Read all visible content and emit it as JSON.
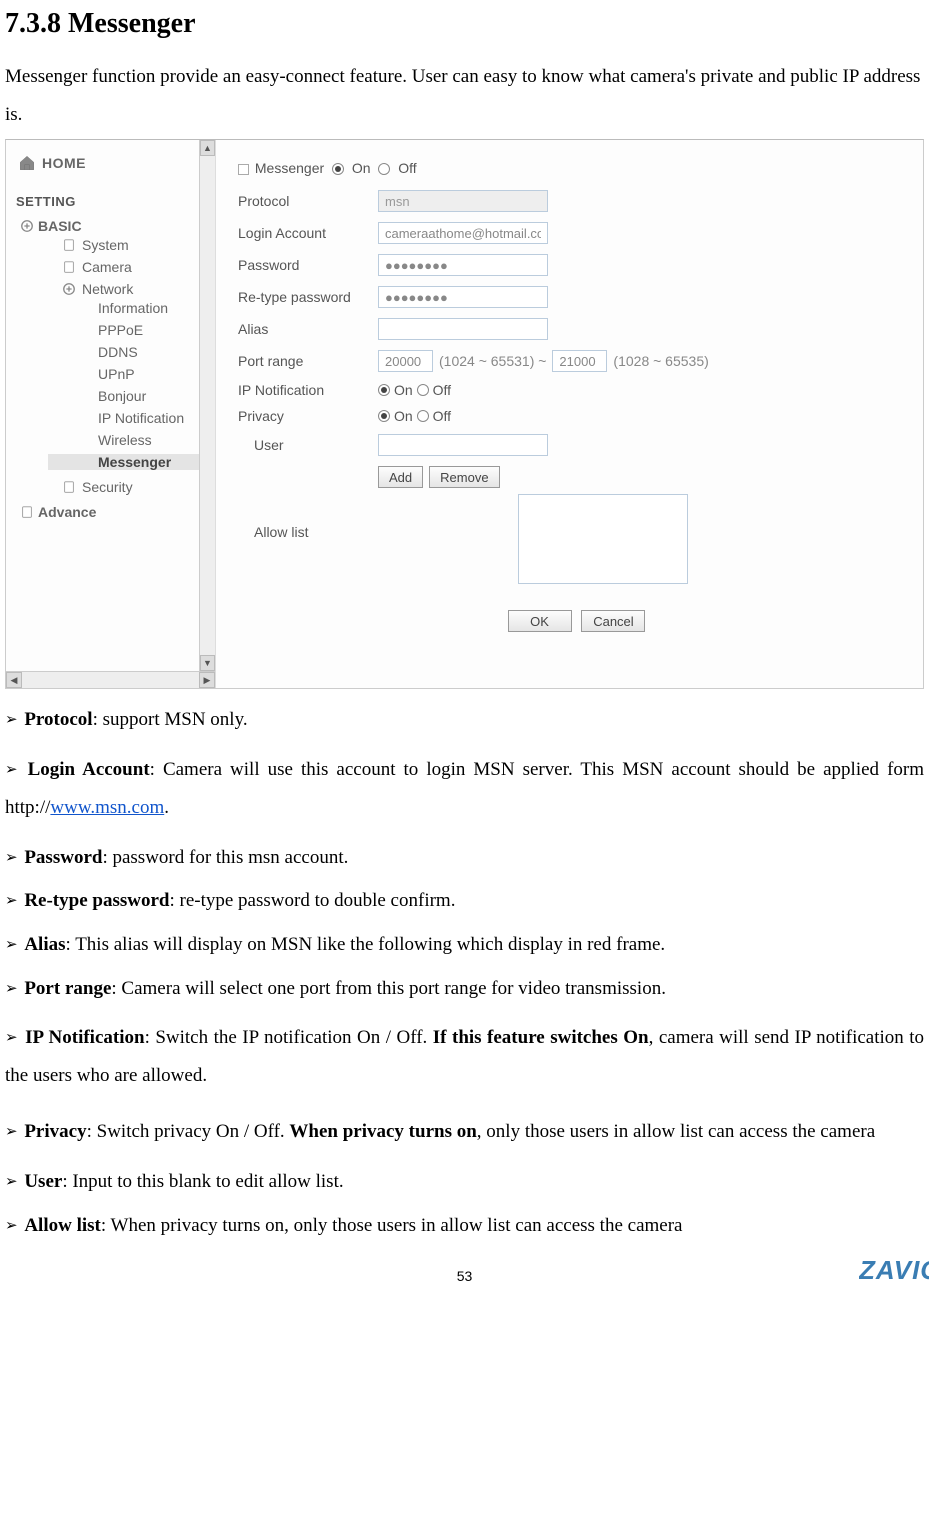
{
  "doc": {
    "heading": "7.3.8 Messenger",
    "intro": "Messenger function provide an easy-connect feature. User can easy to know what camera's private and public IP address is."
  },
  "sidebar": {
    "home": "HOME",
    "setting": "SETTING",
    "basic": "BASIC",
    "items": {
      "system": "System",
      "camera": "Camera",
      "network": "Network",
      "information": "Information",
      "pppoe": "PPPoE",
      "ddns": "DDNS",
      "upnp": "UPnP",
      "bonjour": "Bonjour",
      "ipnotif": "IP Notification",
      "wireless": "Wireless",
      "messenger": "Messenger",
      "security": "Security",
      "advance": "Advance"
    }
  },
  "form": {
    "title_prefix": "Messenger",
    "on": "On",
    "off": "Off",
    "protocol_label": "Protocol",
    "protocol_value": "msn",
    "login_label": "Login Account",
    "login_value": "cameraathome@hotmail.com",
    "password_label": "Password",
    "password_value": "●●●●●●●●",
    "retype_label": "Re-type password",
    "retype_value": "●●●●●●●●",
    "alias_label": "Alias",
    "alias_value": "",
    "port_label": "Port range",
    "port_from": "20000",
    "port_hint_from": "(1024 ~ 65531) ~",
    "port_to": "21000",
    "port_hint_to": "(1028 ~ 65535)",
    "ipnotif_label": "IP Notification",
    "privacy_label": "Privacy",
    "user_label": "User",
    "user_value": "",
    "add": "Add",
    "remove": "Remove",
    "allowlist_label": "Allow list",
    "ok": "OK",
    "cancel": "Cancel"
  },
  "bullets": {
    "protocol_b": "Protocol",
    "protocol_t": ": support MSN only.",
    "login_b": "Login Account",
    "login_t": ": Camera will use this account to login MSN server. This MSN account should be applied form http://",
    "login_link": "www.msn.com",
    "login_t2": ".",
    "password_b": "Password",
    "password_t": ": password for this msn account.",
    "retype_b": "Re-type password",
    "retype_t": ": re-type password to double confirm.",
    "alias_b": "Alias",
    "alias_t": ": This alias will display on MSN like the following which display in red frame.",
    "port_b": "Port range",
    "port_t": ": Camera will select one port from this port range for video transmission.",
    "ipnotif_b": "IP Notification",
    "ipnotif_t1": ": Switch the IP notification On / Off. ",
    "ipnotif_t2": "If this feature switches On",
    "ipnotif_t3": ", camera will send IP notification to the users who are allowed.",
    "privacy_b": "Privacy",
    "privacy_t1": ": Switch privacy On / Off. ",
    "privacy_t2": "When privacy turns on",
    "privacy_t3": ", only those users in allow list can access the camera",
    "user_b": "User",
    "user_t": ": Input to this blank to edit allow list.",
    "allow_b": "Allow list",
    "allow_t": ": When privacy turns on, only those users in allow list can access the camera"
  },
  "pagenum": "53",
  "brand": "ZAVIO"
}
